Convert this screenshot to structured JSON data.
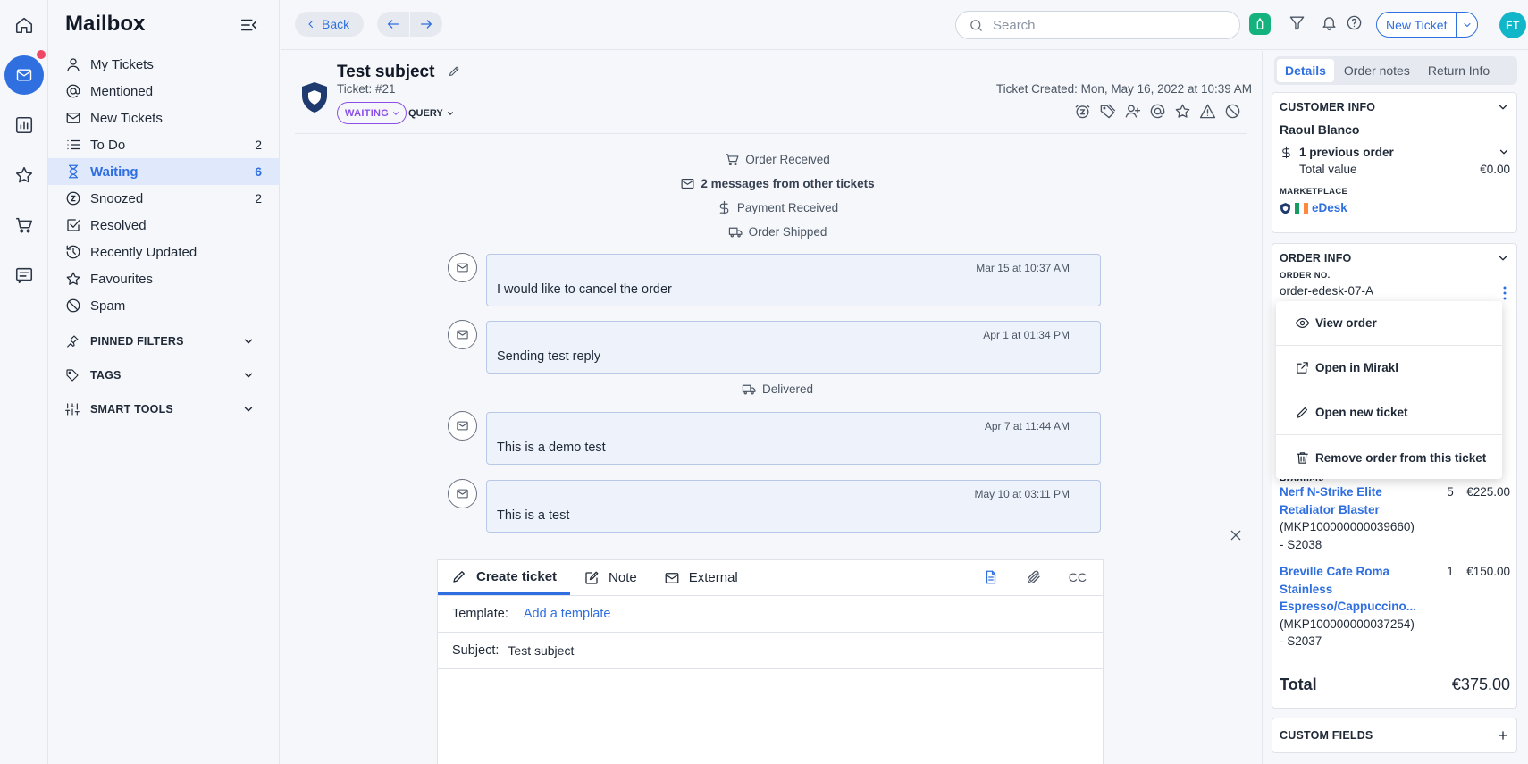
{
  "sidebar": {
    "title": "Mailbox",
    "items": [
      {
        "label": "My Tickets",
        "count": "",
        "icon": "user-icon"
      },
      {
        "label": "Mentioned",
        "count": "",
        "icon": "at-icon"
      },
      {
        "label": "New Tickets",
        "count": "",
        "icon": "envelope-icon"
      },
      {
        "label": "To Do",
        "count": "2",
        "icon": "list-icon"
      },
      {
        "label": "Waiting",
        "count": "6",
        "icon": "hourglass-icon"
      },
      {
        "label": "Snoozed",
        "count": "2",
        "icon": "snooze-icon"
      },
      {
        "label": "Resolved",
        "count": "",
        "icon": "check-square-icon"
      },
      {
        "label": "Recently Updated",
        "count": "",
        "icon": "history-icon"
      },
      {
        "label": "Favourites",
        "count": "",
        "icon": "star-icon"
      },
      {
        "label": "Spam",
        "count": "",
        "icon": "ban-icon"
      }
    ],
    "sections": [
      {
        "label": "PINNED FILTERS"
      },
      {
        "label": "TAGS"
      },
      {
        "label": "SMART TOOLS"
      }
    ]
  },
  "topbar": {
    "back_label": "Back",
    "search_placeholder": "Search",
    "new_ticket_label": "New Ticket",
    "avatar_initials": "FT"
  },
  "ticket": {
    "title": "Test subject",
    "number": "Ticket: #21",
    "status": "WAITING",
    "type": "QUERY",
    "created": "Ticket Created: Mon, May 16, 2022 at 10:39 AM"
  },
  "timeline": {
    "events": [
      {
        "label": "Order Received"
      },
      {
        "label": "2 messages from other tickets"
      },
      {
        "label": "Payment Received"
      },
      {
        "label": "Order Shipped"
      },
      {
        "label": "Delivered"
      }
    ],
    "messages": [
      {
        "time": "Mar 15 at 10:37 AM",
        "body": "I would like to cancel the order"
      },
      {
        "time": "Apr 1 at 01:34 PM",
        "body": "Sending test reply"
      },
      {
        "time": "Apr 7 at 11:44 AM",
        "body": "This is a demo test"
      },
      {
        "time": "May 10 at 03:11 PM",
        "body": "This is a test"
      }
    ]
  },
  "composer": {
    "tabs": [
      {
        "label": "Create ticket"
      },
      {
        "label": "Note"
      },
      {
        "label": "External"
      }
    ],
    "cc_label": "CC",
    "template_label": "Template:",
    "template_link": "Add a template",
    "subject_label": "Subject:",
    "subject_value": "Test subject"
  },
  "right_panel": {
    "tabs": [
      {
        "label": "Details"
      },
      {
        "label": "Order notes"
      },
      {
        "label": "Return Info"
      }
    ],
    "customer": {
      "heading": "CUSTOMER INFO",
      "name": "Raoul Blanco",
      "orders": "1 previous order",
      "total_label": "Total value",
      "total_value": "€0.00",
      "marketplace_label": "MARKETPLACE",
      "marketplace": "eDesk"
    },
    "order": {
      "heading": "ORDER INFO",
      "number_label": "ORDER NO.",
      "number": "order-edesk-07-A",
      "products_label_partial": "Products",
      "products": [
        {
          "name1": "Nerf N-Strike Elite",
          "name2": "Retaliator Blaster",
          "sku": "(MKP100000000039660)",
          "code": "- S2038",
          "qty": "5",
          "price": "€225.00"
        },
        {
          "name1": "Breville Cafe Roma",
          "name2": "Stainless",
          "name3": "Espresso/Cappuccino...",
          "sku": "(MKP100000000037254)",
          "code": "- S2037",
          "qty": "1",
          "price": "€150.00"
        }
      ],
      "total_label": "Total",
      "total_value": "€375.00"
    },
    "custom_fields": "CUSTOM FIELDS",
    "menu": [
      {
        "label": "View order"
      },
      {
        "label": "Open in Mirakl"
      },
      {
        "label": "Open new ticket"
      },
      {
        "label": "Remove order from this ticket"
      }
    ]
  },
  "colors": {
    "accent": "#2f6fe0",
    "status_waiting": "#8b4fe8",
    "avatar": "#12b6c9",
    "notification": "#ef4765",
    "brand_green": "#14b37d"
  }
}
